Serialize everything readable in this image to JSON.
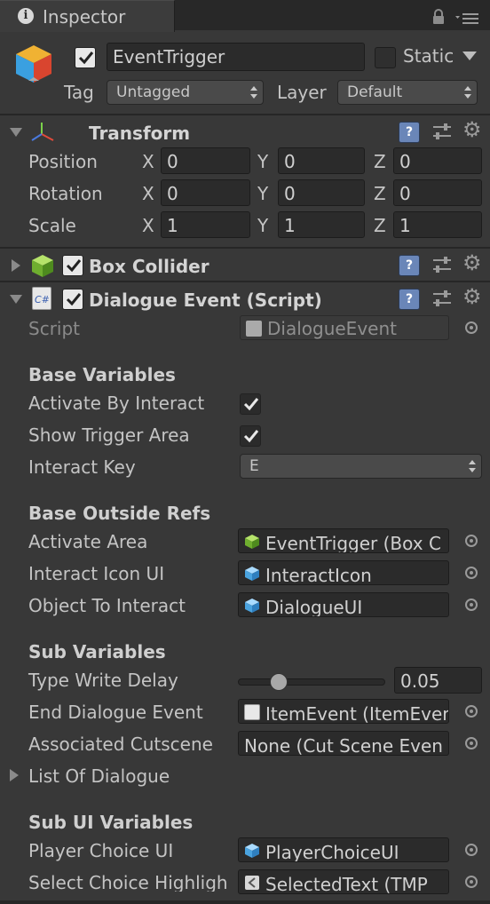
{
  "tab": {
    "title": "Inspector"
  },
  "header": {
    "name": "EventTrigger",
    "static_label": "Static",
    "tag_label": "Tag",
    "tag_value": "Untagged",
    "layer_label": "Layer",
    "layer_value": "Default"
  },
  "transform": {
    "title": "Transform",
    "rows": [
      {
        "label": "Position",
        "x": "0",
        "y": "0",
        "z": "0"
      },
      {
        "label": "Rotation",
        "x": "0",
        "y": "0",
        "z": "0"
      },
      {
        "label": "Scale",
        "x": "1",
        "y": "1",
        "z": "1"
      }
    ],
    "axis_x": "X",
    "axis_y": "Y",
    "axis_z": "Z"
  },
  "box_collider": {
    "title": "Box Collider"
  },
  "script_comp": {
    "title": "Dialogue Event (Script)",
    "script_label": "Script",
    "script_value": "DialogueEvent",
    "cs_icon_text": "C#"
  },
  "base_variables": {
    "header": "Base Variables",
    "activate_by_interact": "Activate By Interact",
    "show_trigger_area": "Show Trigger Area",
    "interact_key_label": "Interact Key",
    "interact_key_value": "E"
  },
  "base_outside_refs": {
    "header": "Base Outside Refs",
    "activate_area_label": "Activate Area",
    "activate_area_value": "EventTrigger (Box C",
    "interact_icon_label": "Interact Icon UI",
    "interact_icon_value": "InteractIcon",
    "object_to_interact_label": "Object To Interact",
    "object_to_interact_value": "DialogueUI"
  },
  "sub_variables": {
    "header": "Sub Variables",
    "type_write_label": "Type Write Delay",
    "type_write_value": "0.05",
    "type_write_fraction": 0.24,
    "end_dialogue_label": "End Dialogue Event",
    "end_dialogue_value": "ItemEvent (ItemEven",
    "cutscene_label": "Associated Cutscene",
    "cutscene_value": "None (Cut Scene Even",
    "list_label": "List Of Dialogue"
  },
  "sub_ui_variables": {
    "header": "Sub UI Variables",
    "player_choice_label": "Player Choice UI",
    "player_choice_value": "PlayerChoiceUI",
    "select_choice_label": "Select Choice Highligh",
    "select_choice_value": "SelectedText (TMP_"
  },
  "colors": {
    "background": "#383838",
    "field": "#2b2b2b",
    "cube_green": "#8bc34a",
    "cube_blue": "#4aa3df"
  }
}
